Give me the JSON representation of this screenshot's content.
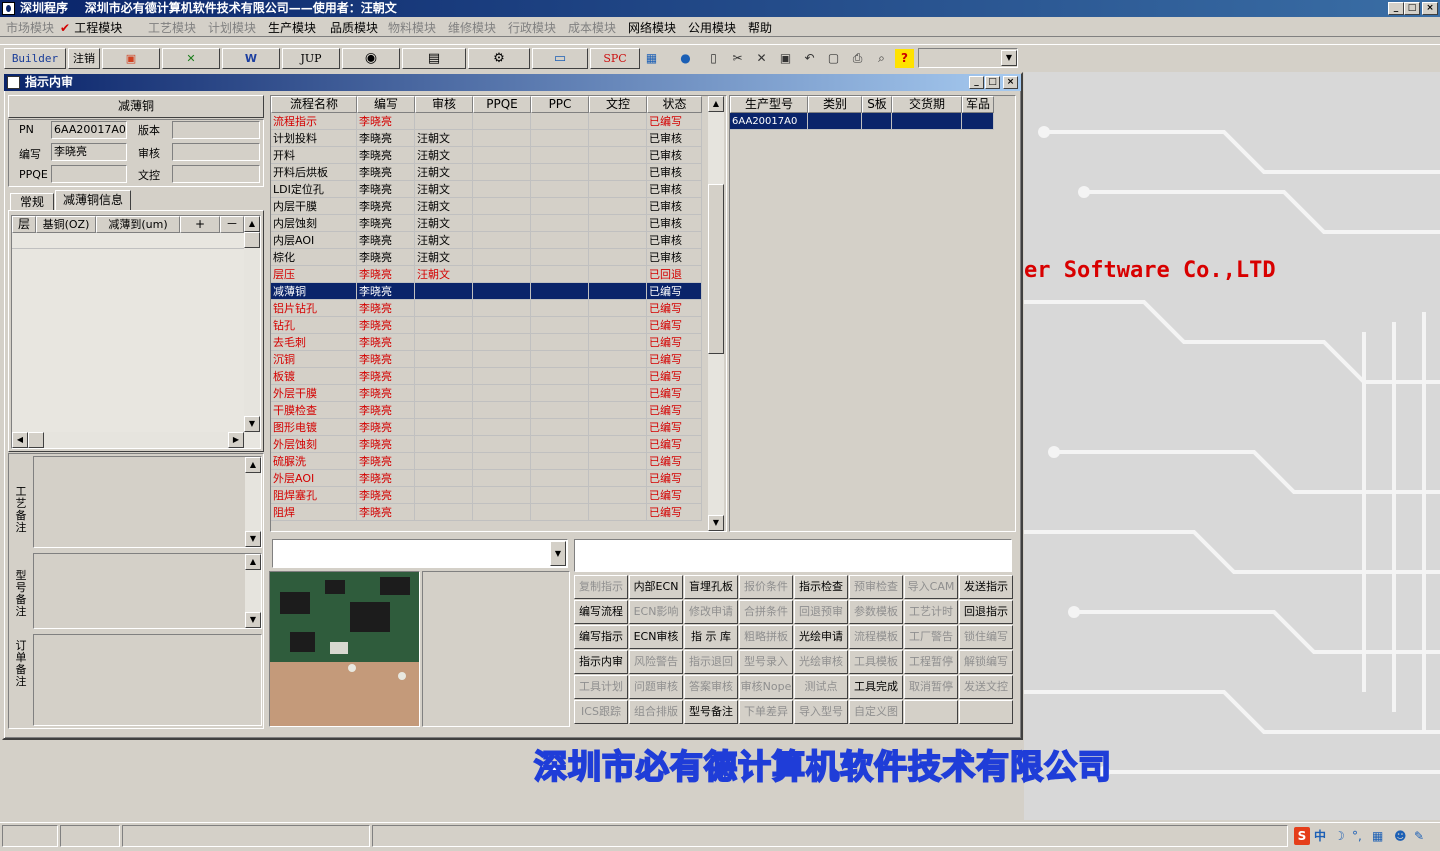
{
  "window": {
    "title": "深圳程序    深圳市必有德计算机软件技术有限公司——使用者：汪朝文",
    "btn_min": "_",
    "btn_max": "□",
    "btn_close": "×"
  },
  "menu": [
    {
      "label": "市场模块",
      "enabled": false
    },
    {
      "label": "工程模块",
      "enabled": true,
      "checked": true
    },
    {
      "label": "工艺模块",
      "enabled": false
    },
    {
      "label": "计划模块",
      "enabled": false
    },
    {
      "label": "生产模块",
      "enabled": true
    },
    {
      "label": "品质模块",
      "enabled": true
    },
    {
      "label": "物料模块",
      "enabled": false
    },
    {
      "label": "维修模块",
      "enabled": false
    },
    {
      "label": "行政模块",
      "enabled": false
    },
    {
      "label": "成本模块",
      "enabled": false
    },
    {
      "label": "网络模块",
      "enabled": true
    },
    {
      "label": "公用模块",
      "enabled": true
    },
    {
      "label": "帮助",
      "enabled": true
    }
  ],
  "toolbar": {
    "builder": "Builder",
    "logout": "注销",
    "jup": "JUP",
    "spc": "SPC",
    "icons": [
      "ppt-icon",
      "excel-icon",
      "word-icon",
      "eye-icon",
      "database-icon",
      "gears-icon",
      "computer-icon",
      "calendar-icon",
      "globe-icon",
      "new-doc-icon",
      "cut-icon",
      "delete-icon",
      "save-icon",
      "undo-icon",
      "preview-icon",
      "print-icon",
      "find-icon",
      "help-icon"
    ]
  },
  "child_window": {
    "title": "指示内审",
    "btn_min": "_",
    "btn_max": "□",
    "btn_close": "×"
  },
  "left_panel": {
    "section_title": "减薄铜",
    "labels": {
      "pn": "PN",
      "version": "版本",
      "author": "编写",
      "review": "审核",
      "ppqe": "PPQE",
      "doc_control": "文控"
    },
    "values": {
      "pn": "6AA20017A0",
      "version": "",
      "author": "李晓亮",
      "review": "",
      "ppqe": "",
      "doc_control": ""
    },
    "tabs": [
      "常规",
      "减薄铜信息"
    ],
    "active_tab": 1,
    "table_headers": [
      "层",
      "基铜(OZ)",
      "减薄到(um)",
      "+",
      "－"
    ],
    "remarks": [
      "工艺备注",
      "型号备注",
      "订单备注"
    ]
  },
  "process_table": {
    "headers": [
      "流程名称",
      "编写",
      "审核",
      "PPQE",
      "PPC",
      "文控",
      "状态"
    ],
    "rows": [
      {
        "name": "流程指示",
        "author": "李晓亮",
        "review": "",
        "ppqe": "",
        "ppc": "",
        "doc": "",
        "status": "已编写",
        "style": "red"
      },
      {
        "name": "计划投料",
        "author": "李晓亮",
        "review": "汪朝文",
        "ppqe": "",
        "ppc": "",
        "doc": "",
        "status": "已审核",
        "style": "normal"
      },
      {
        "name": "开料",
        "author": "李晓亮",
        "review": "汪朝文",
        "ppqe": "",
        "ppc": "",
        "doc": "",
        "status": "已审核",
        "style": "normal"
      },
      {
        "name": "开料后烘板",
        "author": "李晓亮",
        "review": "汪朝文",
        "ppqe": "",
        "ppc": "",
        "doc": "",
        "status": "已审核",
        "style": "normal"
      },
      {
        "name": "LDI定位孔",
        "author": "李晓亮",
        "review": "汪朝文",
        "ppqe": "",
        "ppc": "",
        "doc": "",
        "status": "已审核",
        "style": "normal"
      },
      {
        "name": "内层干膜",
        "author": "李晓亮",
        "review": "汪朝文",
        "ppqe": "",
        "ppc": "",
        "doc": "",
        "status": "已审核",
        "style": "normal"
      },
      {
        "name": "内层蚀刻",
        "author": "李晓亮",
        "review": "汪朝文",
        "ppqe": "",
        "ppc": "",
        "doc": "",
        "status": "已审核",
        "style": "normal"
      },
      {
        "name": "内层AOI",
        "author": "李晓亮",
        "review": "汪朝文",
        "ppqe": "",
        "ppc": "",
        "doc": "",
        "status": "已审核",
        "style": "normal"
      },
      {
        "name": "棕化",
        "author": "李晓亮",
        "review": "汪朝文",
        "ppqe": "",
        "ppc": "",
        "doc": "",
        "status": "已审核",
        "style": "normal"
      },
      {
        "name": "层压",
        "author": "李晓亮",
        "review": "汪朝文",
        "ppqe": "",
        "ppc": "",
        "doc": "",
        "status": "已回退",
        "style": "red"
      },
      {
        "name": "减薄铜",
        "author": "李晓亮",
        "review": "",
        "ppqe": "",
        "ppc": "",
        "doc": "",
        "status": "已编写",
        "style": "sel"
      },
      {
        "name": "铝片钻孔",
        "author": "李晓亮",
        "review": "",
        "ppqe": "",
        "ppc": "",
        "doc": "",
        "status": "已编写",
        "style": "red"
      },
      {
        "name": "钻孔",
        "author": "李晓亮",
        "review": "",
        "ppqe": "",
        "ppc": "",
        "doc": "",
        "status": "已编写",
        "style": "red"
      },
      {
        "name": "去毛刺",
        "author": "李晓亮",
        "review": "",
        "ppqe": "",
        "ppc": "",
        "doc": "",
        "status": "已编写",
        "style": "red"
      },
      {
        "name": "沉铜",
        "author": "李晓亮",
        "review": "",
        "ppqe": "",
        "ppc": "",
        "doc": "",
        "status": "已编写",
        "style": "red"
      },
      {
        "name": "板镀",
        "author": "李晓亮",
        "review": "",
        "ppqe": "",
        "ppc": "",
        "doc": "",
        "status": "已编写",
        "style": "red"
      },
      {
        "name": "外层干膜",
        "author": "李晓亮",
        "review": "",
        "ppqe": "",
        "ppc": "",
        "doc": "",
        "status": "已编写",
        "style": "red"
      },
      {
        "name": "干膜检查",
        "author": "李晓亮",
        "review": "",
        "ppqe": "",
        "ppc": "",
        "doc": "",
        "status": "已编写",
        "style": "red"
      },
      {
        "name": "图形电镀",
        "author": "李晓亮",
        "review": "",
        "ppqe": "",
        "ppc": "",
        "doc": "",
        "status": "已编写",
        "style": "red"
      },
      {
        "name": "外层蚀刻",
        "author": "李晓亮",
        "review": "",
        "ppqe": "",
        "ppc": "",
        "doc": "",
        "status": "已编写",
        "style": "red"
      },
      {
        "name": "硫脲洗",
        "author": "李晓亮",
        "review": "",
        "ppqe": "",
        "ppc": "",
        "doc": "",
        "status": "已编写",
        "style": "red"
      },
      {
        "name": "外层AOI",
        "author": "李晓亮",
        "review": "",
        "ppqe": "",
        "ppc": "",
        "doc": "",
        "status": "已编写",
        "style": "red"
      },
      {
        "name": "阻焊塞孔",
        "author": "李晓亮",
        "review": "",
        "ppqe": "",
        "ppc": "",
        "doc": "",
        "status": "已编写",
        "style": "red"
      },
      {
        "name": "阻焊",
        "author": "李晓亮",
        "review": "",
        "ppqe": "",
        "ppc": "",
        "doc": "",
        "status": "已编写",
        "style": "red"
      }
    ]
  },
  "model_table": {
    "headers": [
      "生产型号",
      "类别",
      "S板",
      "交货期",
      "军品"
    ],
    "rows": [
      {
        "model": "6AA20017A0",
        "category": "",
        "s_board": "",
        "delivery": "",
        "military": ""
      }
    ]
  },
  "buttons": [
    [
      {
        "label": "复制指示",
        "enabled": false
      },
      {
        "label": "内部ECN",
        "enabled": true
      },
      {
        "label": "盲埋孔板",
        "enabled": true
      },
      {
        "label": "报价条件",
        "enabled": false
      },
      {
        "label": "指示检查",
        "enabled": true
      },
      {
        "label": "预审检查",
        "enabled": false
      },
      {
        "label": "导入CAM",
        "enabled": false
      },
      {
        "label": "发送指示",
        "enabled": true
      }
    ],
    [
      {
        "label": "编写流程",
        "enabled": true
      },
      {
        "label": "ECN影响",
        "enabled": false
      },
      {
        "label": "修改申请",
        "enabled": false
      },
      {
        "label": "合拼条件",
        "enabled": false
      },
      {
        "label": "回退预审",
        "enabled": false
      },
      {
        "label": "参数模板",
        "enabled": false
      },
      {
        "label": "工艺计时",
        "enabled": false
      },
      {
        "label": "回退指示",
        "enabled": true
      }
    ],
    [
      {
        "label": "编写指示",
        "enabled": true
      },
      {
        "label": "ECN审核",
        "enabled": true
      },
      {
        "label": "指 示 库",
        "enabled": true
      },
      {
        "label": "粗略拼板",
        "enabled": false
      },
      {
        "label": "光绘申请",
        "enabled": true
      },
      {
        "label": "流程模板",
        "enabled": false
      },
      {
        "label": "工厂警告",
        "enabled": false
      },
      {
        "label": "锁住编写",
        "enabled": false
      }
    ],
    [
      {
        "label": "指示内审",
        "enabled": true
      },
      {
        "label": "风险警告",
        "enabled": false
      },
      {
        "label": "指示退回",
        "enabled": false
      },
      {
        "label": "型号录入",
        "enabled": false
      },
      {
        "label": "光绘审核",
        "enabled": false
      },
      {
        "label": "工具模板",
        "enabled": false
      },
      {
        "label": "工程暂停",
        "enabled": false
      },
      {
        "label": "解锁编写",
        "enabled": false
      }
    ],
    [
      {
        "label": "工具计划",
        "enabled": false
      },
      {
        "label": "问题审核",
        "enabled": false
      },
      {
        "label": "答案审核",
        "enabled": false
      },
      {
        "label": "审核Nope",
        "enabled": false
      },
      {
        "label": "测试点",
        "enabled": false
      },
      {
        "label": "工具完成",
        "enabled": true
      },
      {
        "label": "取消暂停",
        "enabled": false
      },
      {
        "label": "发送文控",
        "enabled": false
      }
    ],
    [
      {
        "label": "ICS跟踪",
        "enabled": false
      },
      {
        "label": "组合排版",
        "enabled": false
      },
      {
        "label": "型号备注",
        "enabled": true
      },
      {
        "label": "下单差异",
        "enabled": false
      },
      {
        "label": "导入型号",
        "enabled": false
      },
      {
        "label": "自定义图",
        "enabled": false
      },
      {
        "label": "",
        "enabled": false
      },
      {
        "label": "",
        "enabled": false
      }
    ]
  ],
  "background": {
    "english_name": "er Software Co.,LTD",
    "company_name": "深圳市必有德计算机软件技术有限公司"
  },
  "tray": {
    "ime": "中",
    "icons": [
      "sogou-icon",
      "moon-icon",
      "punct-icon",
      "keyboard-icon",
      "person-icon",
      "wrench-icon"
    ]
  },
  "colors": {
    "title_blue": "#0a246a",
    "selected_row": "#0a246a",
    "warn_red": "#d40000",
    "bg_text_blue": "#1f3dd8",
    "bg_text_red": "#d80000"
  }
}
